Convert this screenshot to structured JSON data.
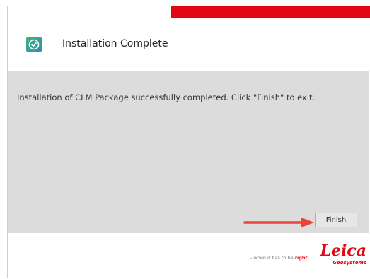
{
  "dialog": {
    "title": "Installation Complete",
    "icon": "check-circle-icon",
    "accent_color": "#e30613"
  },
  "body": {
    "message": "Installation of CLM Package successfully completed. Click \"Finish\" to exit."
  },
  "buttons": {
    "finish_label": "Finish"
  },
  "annotation": {
    "arrow_color": "#e8443a"
  },
  "footer": {
    "tagline_prefix": "- when it has to be",
    "tagline_emphasis": "right",
    "brand_name": "Leica",
    "brand_sub": "Geosystems"
  }
}
